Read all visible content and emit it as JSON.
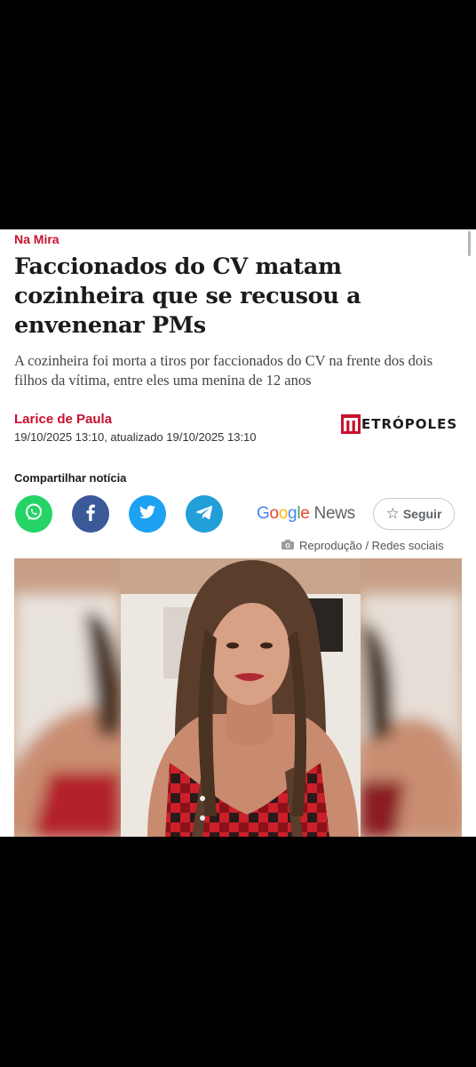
{
  "article": {
    "section": "Na Mira",
    "headline": "Faccionados do CV matam cozinheira que se recusou a envenenar PMs",
    "subtitle": "A cozinheira foi morta a tiros por faccionados do CV na frente dos dois filhos da vítima, entre eles uma menina de 12 anos",
    "author": "Larice de Paula",
    "date": "19/10/2025 13:10, atualizado 19/10/2025 13:10"
  },
  "brand": {
    "logo_text": "ETRÓPOLES",
    "accent_color": "#c8102e"
  },
  "share": {
    "label": "Compartilhar notícia",
    "buttons": [
      {
        "name": "whatsapp",
        "icon": "whatsapp-icon",
        "color": "#25d366"
      },
      {
        "name": "facebook",
        "icon": "facebook-icon",
        "color": "#3b5998"
      },
      {
        "name": "twitter",
        "icon": "twitter-icon",
        "color": "#1da1f2"
      },
      {
        "name": "telegram",
        "icon": "telegram-icon",
        "color": "#229ed9"
      }
    ]
  },
  "google_news": {
    "google": "Google",
    "news": "News",
    "follow_label": "Seguir",
    "follow_icon": "star-icon"
  },
  "photo": {
    "credit": "Reprodução / Redes sociais",
    "credit_icon": "camera-icon"
  }
}
